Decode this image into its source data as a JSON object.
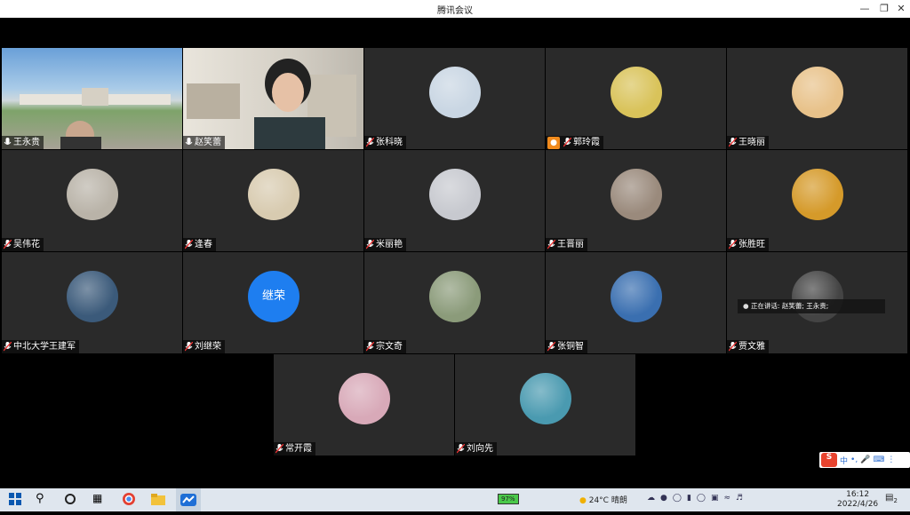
{
  "window": {
    "title": "腾讯会议"
  },
  "participants": [
    {
      "name": "王永贵",
      "type": "video"
    },
    {
      "name": "赵笑蕾",
      "type": "video",
      "active": true
    },
    {
      "name": "张科晓",
      "type": "avatar",
      "color": "#c9d6e3"
    },
    {
      "name": "郭玲霞",
      "type": "avatar",
      "color": "#d9c35a",
      "host": true
    },
    {
      "name": "王晓丽",
      "type": "avatar",
      "color": "#e8c28a"
    },
    {
      "name": "吴伟花",
      "type": "avatar",
      "color": "#b9b3a8"
    },
    {
      "name": "逢春",
      "type": "avatar",
      "color": "#d8cbb0"
    },
    {
      "name": "米丽艳",
      "type": "avatar",
      "color": "#c7c9cf"
    },
    {
      "name": "王晋丽",
      "type": "avatar",
      "color": "#9a8a7c"
    },
    {
      "name": "张胜旺",
      "type": "avatar",
      "color": "#d59a2a"
    },
    {
      "name": "中北大学王建军",
      "type": "avatar",
      "color": "#3b5a7a"
    },
    {
      "name": "刘继荣",
      "type": "text-avatar",
      "initials": "继荣",
      "color": "#1e7ef0"
    },
    {
      "name": "宗文奇",
      "type": "avatar",
      "color": "#8b9b7a"
    },
    {
      "name": "张铜智",
      "type": "avatar",
      "color": "#3a6fb0"
    },
    {
      "name": "贾文雅",
      "type": "avatar",
      "color": "#444444"
    },
    {
      "name": "常开霞",
      "type": "avatar",
      "color": "#d8a9b8"
    },
    {
      "name": "刘向先",
      "type": "avatar",
      "color": "#4a9ab0"
    }
  ],
  "speaking_banner": "正在讲话: 赵笑蕾; 王永贵;",
  "ime": {
    "label": "中"
  },
  "taskbar": {
    "battery": "97%",
    "weather": "24°C 晴朗",
    "time": "16:12",
    "date": "2022/4/26",
    "notifications": "2"
  }
}
